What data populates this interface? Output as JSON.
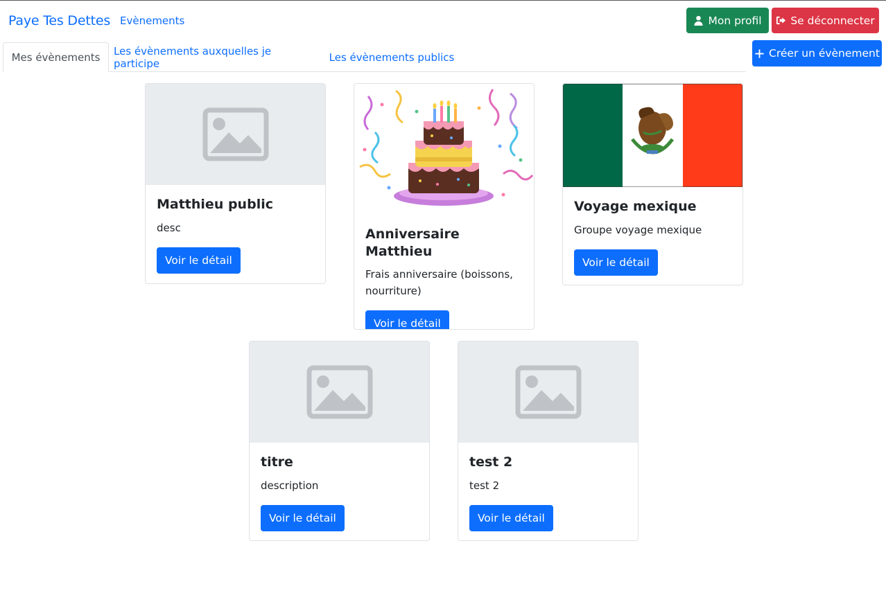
{
  "app": {
    "brand": "Paye Tes Dettes",
    "nav_link": "Evènements"
  },
  "header_buttons": {
    "profile": "Mon profil",
    "logout": "Se déconnecter",
    "create": "Créer un évènement"
  },
  "tabs": [
    {
      "label": "Mes évènements",
      "active": true
    },
    {
      "label": "Les évènements auxquelles je participe",
      "active": false
    },
    {
      "label": "Les évènements publics",
      "active": false
    }
  ],
  "colors": {
    "primary": "#0d6efd",
    "success": "#198754",
    "danger": "#dc3545",
    "placeholder_bg": "#e9ecef"
  },
  "events": [
    {
      "title": "Matthieu public",
      "description": "desc",
      "button": "Voir le détail",
      "image": "placeholder-icon"
    },
    {
      "title": "Anniversaire Matthieu",
      "description": "Frais anniversaire (boissons, nourriture)",
      "button": "Voir le détail",
      "image": "birthday-cake-image"
    },
    {
      "title": "Voyage mexique",
      "description": "Groupe voyage mexique",
      "button": "Voir le détail",
      "image": "mexico-flag-image"
    },
    {
      "title": "titre",
      "description": "description",
      "button": "Voir le détail",
      "image": "placeholder-icon"
    },
    {
      "title": "test 2",
      "description": "test 2",
      "button": "Voir le détail",
      "image": "placeholder-icon"
    }
  ]
}
